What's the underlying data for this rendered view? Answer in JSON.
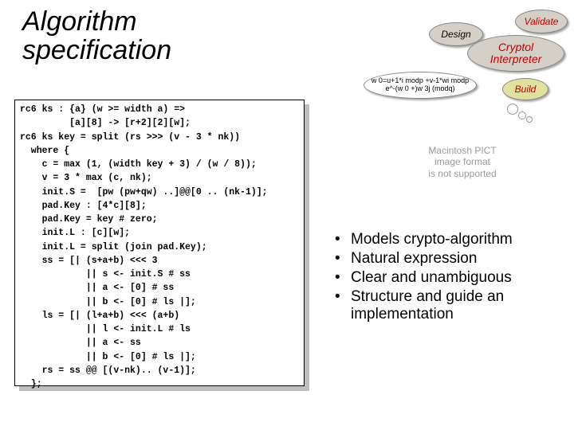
{
  "title_line1": "Algorithm",
  "title_line2": "specification",
  "diagram": {
    "design": "Design",
    "validate": "Validate",
    "cryptol_l1": "Cryptol",
    "cryptol_l2": "Interpreter",
    "build": "Build",
    "formula_l1": "w 0=u+1*i modp +v-1*wi modp",
    "formula_l2": "e^-(w 0 +)w 3j (modq)"
  },
  "placeholder": {
    "l1": "Macintosh PICT",
    "l2": "image format",
    "l3": "is not supported"
  },
  "code_lines": [
    "rc6 ks : {a} (w >= width a) =>",
    "         [a][8] -> [r+2][2][w];",
    "rc6 ks key = split (rs >>> (v - 3 * nk))",
    "  where {",
    "    c = max (1, (width key + 3) / (w / 8));",
    "    v = 3 * max (c, nk);",
    "    init.S =  [pw (pw+qw) ..]@@[0 .. (nk-1)];",
    "    pad.Key : [4*c][8];",
    "    pad.Key = key # zero;",
    "    init.L : [c][w];",
    "    init.L = split (join pad.Key);",
    "    ss = [| (s+a+b) <<< 3",
    "            || s <- init.S # ss",
    "            || a <- [0] # ss",
    "            || b <- [0] # ls |];",
    "    ls = [| (l+a+b) <<< (a+b)",
    "            || l <- init.L # ls",
    "            || a <- ss",
    "            || b <- [0] # ls |];",
    "    rs = ss @@ [(v-nk).. (v-1)];",
    "  };"
  ],
  "bullets": [
    "Models crypto-algorithm",
    "Natural expression",
    "Clear and unambiguous",
    "Structure and guide an implementation"
  ],
  "bullet_marker": "•"
}
